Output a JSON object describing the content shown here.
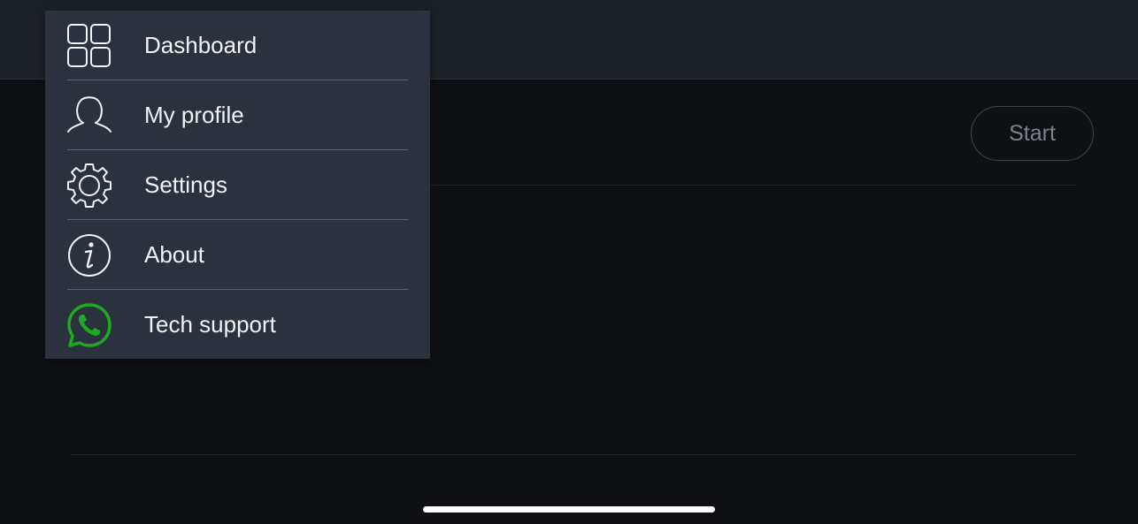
{
  "start_button": {
    "label": "Start"
  },
  "menu": {
    "items": [
      {
        "id": "dashboard",
        "label": "Dashboard",
        "icon": "dashboard-grid-icon"
      },
      {
        "id": "profile",
        "label": "My profile",
        "icon": "user-profile-icon"
      },
      {
        "id": "settings",
        "label": "Settings",
        "icon": "gear-icon"
      },
      {
        "id": "about",
        "label": "About",
        "icon": "info-icon"
      },
      {
        "id": "support",
        "label": "Tech support",
        "icon": "whatsapp-icon"
      }
    ]
  },
  "colors": {
    "background": "#0e1014",
    "menu_background": "#2b323d",
    "whatsapp_green": "#1fa821"
  }
}
